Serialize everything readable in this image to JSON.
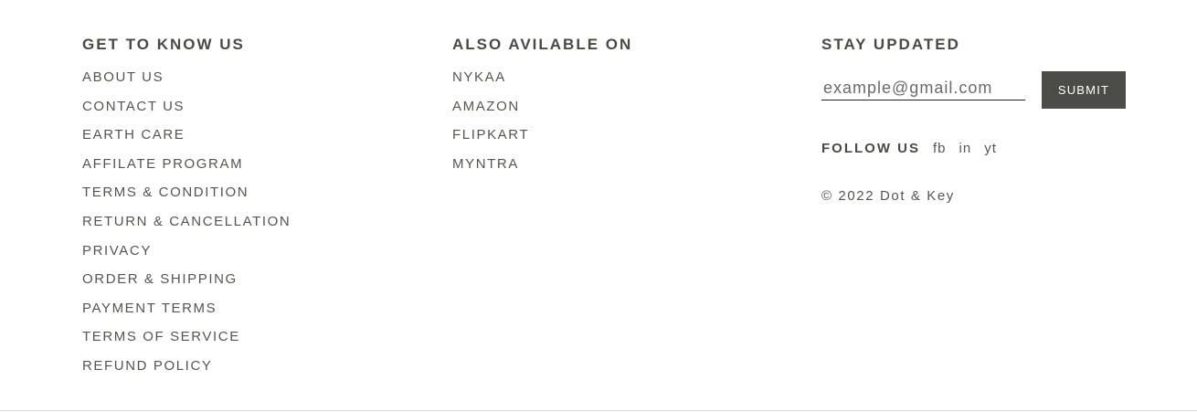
{
  "know_us": {
    "heading": "GET TO KNOW US",
    "links": [
      "ABOUT US",
      "CONTACT US",
      "EARTH CARE",
      "AFFILATE PROGRAM",
      "TERMS & CONDITION",
      "RETURN & CANCELLATION",
      "PRIVACY",
      "ORDER & SHIPPING",
      "PAYMENT TERMS",
      "TERMS OF SERVICE",
      "REFUND POLICY"
    ]
  },
  "available_on": {
    "heading": "ALSO AVILABLE ON",
    "links": [
      "NYKAA",
      "AMAZON",
      "FLIPKART",
      "MYNTRA"
    ]
  },
  "stay_updated": {
    "heading": "STAY UPDATED",
    "email_placeholder": "example@gmail.com",
    "email_value": "",
    "submit_label": "SUBMIT",
    "follow_label": "FOLLOW US",
    "social": [
      "fb",
      "in",
      "yt"
    ],
    "copyright": "© 2022 Dot & Key"
  },
  "colors": {
    "text": "#555550",
    "heading": "#4a4a45",
    "button_bg": "#4c4c46",
    "button_text": "#ffffff",
    "divider": "#dcdcdc"
  }
}
